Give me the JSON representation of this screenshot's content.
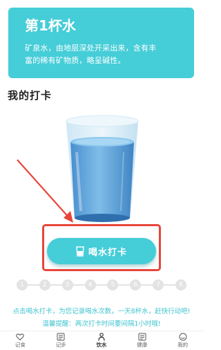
{
  "info_card": {
    "title": "第1杯水",
    "description_line1": "矿泉水，由地层深处开采出来，含有丰",
    "description_line2": "富的稀有矿物质，略呈碱性。",
    "background_color": "#45cdd8"
  },
  "section": {
    "title": "我的打卡"
  },
  "checkin": {
    "button_label": "喝水打卡",
    "icon": "cup-icon"
  },
  "progress": {
    "steps": [
      "1",
      "2",
      "3",
      "4",
      "5",
      "6",
      "7",
      "8"
    ],
    "completed": 0
  },
  "hints": {
    "line1": "点击喝水打卡，为您记录喝水次数，一天8杯水，赶快行动吧!",
    "line2": "温馨提醒：两次打卡时间要间隔1小时哦!"
  },
  "bottom_nav": {
    "items": [
      {
        "label": "记食",
        "icon": "heart-icon"
      },
      {
        "label": "记步",
        "icon": "steps-icon"
      },
      {
        "label": "饮水",
        "icon": "person-icon"
      },
      {
        "label": "健康",
        "icon": "health-icon"
      },
      {
        "label": "我的",
        "icon": "profile-icon"
      }
    ],
    "active_index": 2
  },
  "colors": {
    "accent": "#45cdd8",
    "hint_text": "#3fc4cf",
    "annotation_red": "#e8453a"
  }
}
